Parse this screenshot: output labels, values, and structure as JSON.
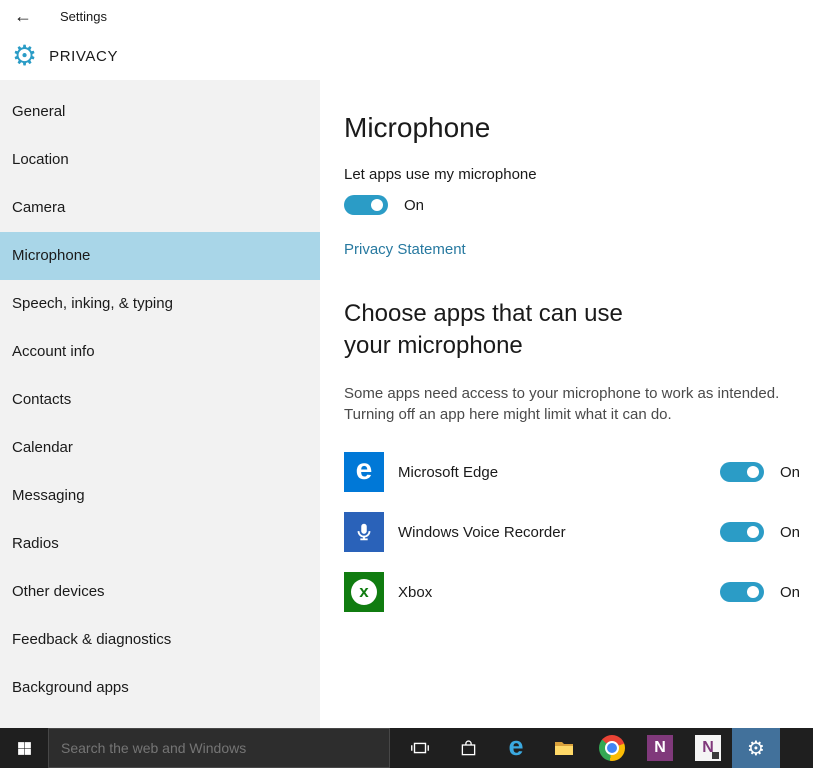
{
  "header": {
    "app_title": "Settings",
    "page_title": "PRIVACY"
  },
  "sidebar": {
    "items": [
      {
        "label": "General",
        "selected": false
      },
      {
        "label": "Location",
        "selected": false
      },
      {
        "label": "Camera",
        "selected": false
      },
      {
        "label": "Microphone",
        "selected": true
      },
      {
        "label": "Speech, inking, & typing",
        "selected": false
      },
      {
        "label": "Account info",
        "selected": false
      },
      {
        "label": "Contacts",
        "selected": false
      },
      {
        "label": "Calendar",
        "selected": false
      },
      {
        "label": "Messaging",
        "selected": false
      },
      {
        "label": "Radios",
        "selected": false
      },
      {
        "label": "Other devices",
        "selected": false
      },
      {
        "label": "Feedback & diagnostics",
        "selected": false
      },
      {
        "label": "Background apps",
        "selected": false
      }
    ]
  },
  "main": {
    "title": "Microphone",
    "master_toggle": {
      "label": "Let apps use my microphone",
      "state": "On"
    },
    "privacy_link": "Privacy Statement",
    "section_title": "Choose apps that can use your microphone",
    "section_desc": "Some apps need access to your microphone to work as intended. Turning off an app here might limit what it can do.",
    "apps": [
      {
        "name": "Microsoft Edge",
        "state": "On",
        "icon": "edge-app-icon",
        "tile_color": "#0078d7"
      },
      {
        "name": "Windows Voice Recorder",
        "state": "On",
        "icon": "voice-recorder-app-icon",
        "tile_color": "#2a62b9"
      },
      {
        "name": "Xbox",
        "state": "On",
        "icon": "xbox-app-icon",
        "tile_color": "#107c10"
      }
    ]
  },
  "taskbar": {
    "search_placeholder": "Search the web and Windows",
    "icons": [
      "start-icon",
      "task-view-icon",
      "store-icon",
      "edge-icon",
      "file-explorer-icon",
      "chrome-icon",
      "onenote-icon",
      "onenote-clipper-icon",
      "settings-gear-icon"
    ],
    "active_app": "settings"
  },
  "glyphs": {
    "back": "←",
    "gear": "⚙",
    "edge": "e",
    "onenote": "N",
    "xbox": "x"
  },
  "colors": {
    "accent_toggle": "#2b9cc6",
    "link": "#2779a0",
    "sidebar_selected": "#a9d6e8",
    "sidebar_bg": "#f2f2f2",
    "taskbar_bg": "#1f1f1f",
    "taskbar_active": "#42719b"
  }
}
